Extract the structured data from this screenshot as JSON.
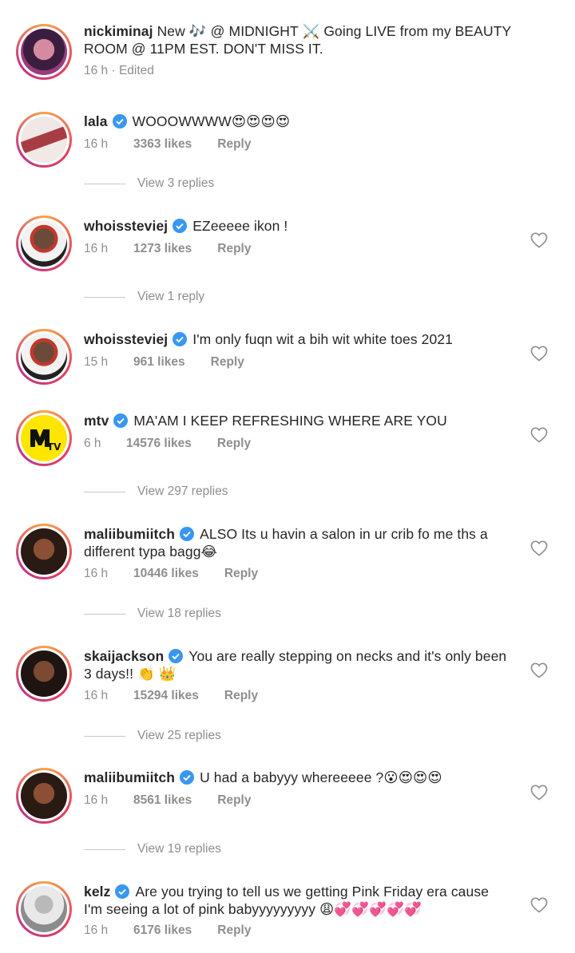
{
  "post": {
    "username": "nickiminaj",
    "caption_line1": "New 🎶 @ MIDNIGHT ⚔️ Going LIVE from my BEAUTY",
    "caption_line2": "ROOM @ 11PM EST. DON'T MISS IT.",
    "time": "16 h",
    "edited": "Edited"
  },
  "comments": [
    {
      "username": "lala",
      "text": "WOOOWWWW😍😍😍😍",
      "time": "16 h",
      "likes": "3363 likes",
      "reply": "Reply",
      "view_replies": "View 3 replies"
    },
    {
      "username": "whoissteviej",
      "text": "EZeeeee ikon !",
      "time": "16 h",
      "likes": "1273 likes",
      "reply": "Reply",
      "view_replies": "View 1 reply"
    },
    {
      "username": "whoissteviej",
      "text": "I'm only fuqn wit a bih wit white toes 2021",
      "time": "15 h",
      "likes": "961 likes",
      "reply": "Reply"
    },
    {
      "username": "mtv",
      "text": "MA'AM I KEEP REFRESHING WHERE ARE YOU",
      "time": "6 h",
      "likes": "14576 likes",
      "reply": "Reply",
      "view_replies": "View 297 replies"
    },
    {
      "username": "maliibumiitch",
      "text": "ALSO Its u havin a salon in ur crib fo me ths a",
      "text2": "different typa bagg😂",
      "time": "16 h",
      "likes": "10446 likes",
      "reply": "Reply",
      "view_replies": "View 18 replies"
    },
    {
      "username": "skaijackson",
      "text": "You are really stepping on necks and it's only been",
      "text2": "3 days!! 👏 👑",
      "time": "16 h",
      "likes": "15294 likes",
      "reply": "Reply",
      "view_replies": "View 25 replies"
    },
    {
      "username": "maliibumiitch",
      "text": "U had a babyyy whereeeee ?😮😍😍😍",
      "time": "16 h",
      "likes": "8561 likes",
      "reply": "Reply",
      "view_replies": "View 19 replies"
    },
    {
      "username": "kelz",
      "text": "Are you trying to tell us we getting Pink Friday era cause",
      "text2": "I'm seeing a lot of pink babyyyyyyyyy 😩💞💞💞💞💞",
      "time": "16 h",
      "likes": "6176 likes",
      "reply": "Reply"
    }
  ],
  "colors": {
    "verified": "#3897f0",
    "muted": "#8e8e8e",
    "text": "#262626"
  }
}
